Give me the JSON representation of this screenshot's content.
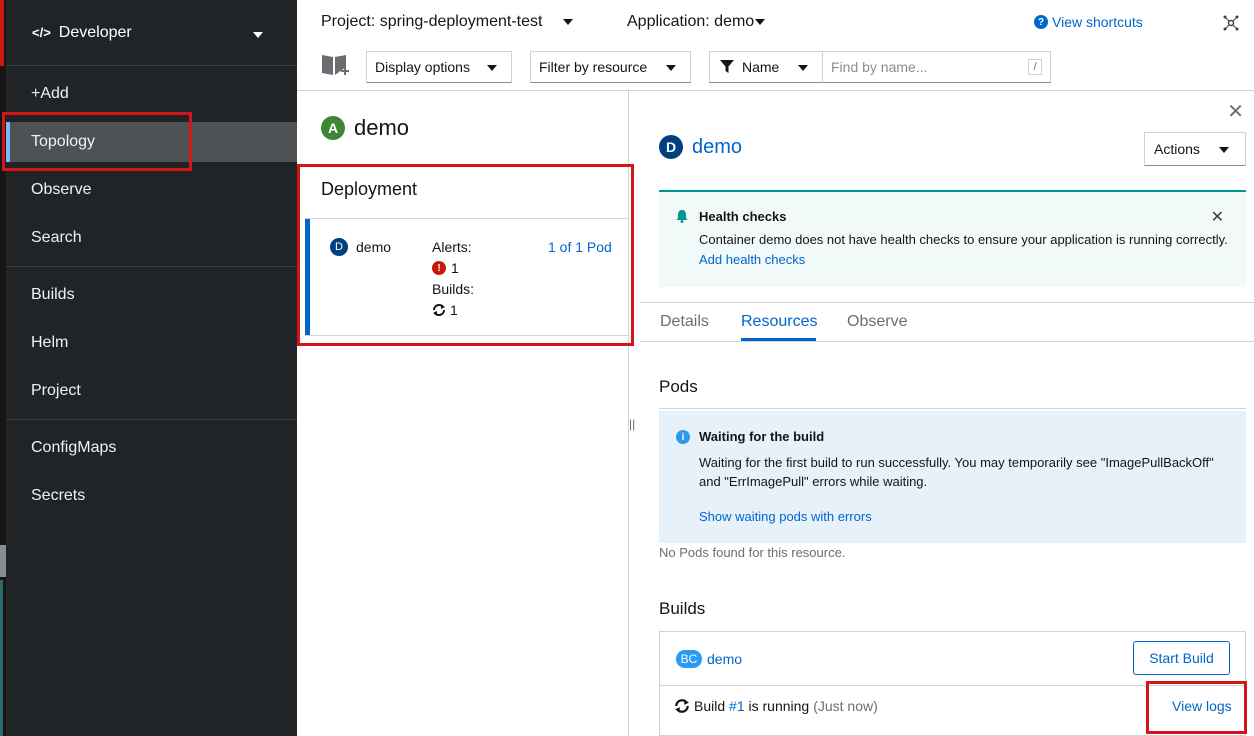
{
  "perspective": {
    "code_icon": "</>",
    "label": "Developer"
  },
  "nav": [
    {
      "label": "+Add"
    },
    {
      "label": "Topology"
    },
    {
      "label": "Observe"
    },
    {
      "label": "Search"
    },
    {
      "label": "Builds"
    },
    {
      "label": "Helm"
    },
    {
      "label": "Project"
    },
    {
      "label": "ConfigMaps"
    },
    {
      "label": "Secrets"
    }
  ],
  "topbar": {
    "project": "Project: spring-deployment-test",
    "application": "Application: demo",
    "shortcuts": "View shortcuts"
  },
  "toolbar": {
    "display_options": "Display options",
    "filter_by_resource": "Filter by resource",
    "name_filter": "Name",
    "search_placeholder": "Find by name...",
    "shortcut_key": "/"
  },
  "left_panel": {
    "app_badge": "A",
    "app_name": "demo",
    "section_title": "Deployment",
    "item": {
      "badge": "D",
      "name": "demo",
      "alerts_label": "Alerts:",
      "alerts_count": "1",
      "builds_label": "Builds:",
      "builds_count": "1",
      "pods": "1 of 1 Pod"
    }
  },
  "right_panel": {
    "badge": "D",
    "title": "demo",
    "actions": "Actions",
    "health": {
      "title": "Health checks",
      "description": "Container demo does not have health checks to ensure your application is running correctly.",
      "link": "Add health checks"
    },
    "tabs": [
      "Details",
      "Resources",
      "Observe"
    ],
    "pods_heading": "Pods",
    "info": {
      "title": "Waiting for the build",
      "description": "Waiting for the first build to run successfully. You may temporarily see \"ImagePullBackOff\" and \"ErrImagePull\" errors while waiting.",
      "link": "Show waiting pods with errors"
    },
    "no_pods": "No Pods found for this resource.",
    "builds_heading": "Builds",
    "build_config": {
      "badge": "BC",
      "name": "demo",
      "start_button": "Start Build"
    },
    "build": {
      "prefix": "Build",
      "number": "#1",
      "status": "is running",
      "when": "(Just now)",
      "view_logs": "View logs"
    }
  },
  "colors": {
    "accent": "#0066cc",
    "sidebar_bg": "#212427",
    "highlight": "#d6151b"
  }
}
